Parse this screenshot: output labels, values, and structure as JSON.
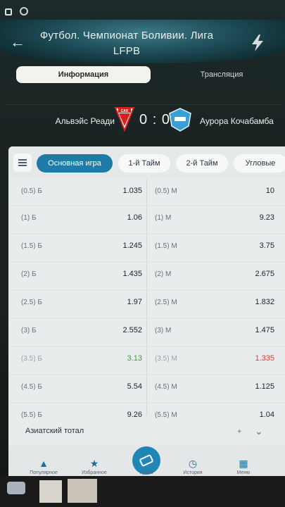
{
  "header": {
    "title": "Футбол. Чемпионат Боливии. Лига LFPB",
    "back_icon": "arrow-left-icon",
    "action_icon": "bolt-icon"
  },
  "tabs": [
    {
      "label": "Информация",
      "active": true
    },
    {
      "label": "Трансляция",
      "active": false
    }
  ],
  "match": {
    "home_team": "Альвэйс Реади",
    "away_team": "Аурора Кочабамба",
    "score": "0 : 0",
    "home_logo_text": "CAR"
  },
  "filters": [
    {
      "label": "Основная игра",
      "active": true
    },
    {
      "label": "1-й Тайм",
      "active": false
    },
    {
      "label": "2-й Тайм",
      "active": false
    },
    {
      "label": "Угловые",
      "active": false
    }
  ],
  "odds": [
    {
      "over_label": "(0.5) Б",
      "over_value": "1.035",
      "under_label": "(0.5) М",
      "under_value": "10"
    },
    {
      "over_label": "(1) Б",
      "over_value": "1.06",
      "under_label": "(1) М",
      "under_value": "9.23"
    },
    {
      "over_label": "(1.5) Б",
      "over_value": "1.245",
      "under_label": "(1.5) М",
      "under_value": "3.75"
    },
    {
      "over_label": "(2) Б",
      "over_value": "1.435",
      "under_label": "(2) М",
      "under_value": "2.675"
    },
    {
      "over_label": "(2.5) Б",
      "over_value": "1.97",
      "under_label": "(2.5) М",
      "under_value": "1.832"
    },
    {
      "over_label": "(3) Б",
      "over_value": "2.552",
      "under_label": "(3) М",
      "under_value": "1.475"
    },
    {
      "over_label": "(3.5) Б",
      "over_value": "3.13",
      "under_label": "(3.5) М",
      "under_value": "1.335"
    },
    {
      "over_label": "(4.5) Б",
      "over_value": "5.54",
      "under_label": "(4.5) М",
      "under_value": "1.125"
    },
    {
      "over_label": "(5.5) Б",
      "over_value": "9.26",
      "under_label": "(5.5) М",
      "under_value": "1.04"
    }
  ],
  "colors": {
    "over_up": "#3e9a3e",
    "under_down": "#d83a3a",
    "accent": "#1f7ca7"
  },
  "asian_total": {
    "label": "Азиатский тотал"
  },
  "bottom_nav": [
    {
      "label": "Популярное",
      "icon": "fire-icon"
    },
    {
      "label": "Избранное",
      "icon": "star-icon"
    },
    {
      "label": "Купон",
      "icon": "ticket-icon"
    },
    {
      "label": "История",
      "icon": "clock-icon"
    },
    {
      "label": "Меню",
      "icon": "grid-icon"
    }
  ]
}
